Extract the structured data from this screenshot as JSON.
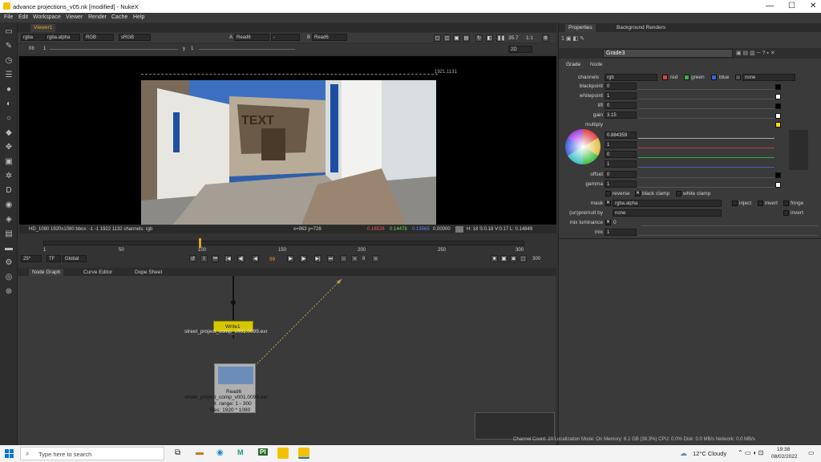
{
  "window": {
    "title": "advance projections_v05.nk [modified] - NukeX",
    "min": "—",
    "max": "☐",
    "close": "✕"
  },
  "menu": [
    "File",
    "Edit",
    "Workspace",
    "Viewer",
    "Render",
    "Cache",
    "Help"
  ],
  "viewer": {
    "tab": "Viewer1",
    "channels": "rgba",
    "alpha": "rgba.alpha",
    "colorspace": "RGB",
    "lut": "sRGB",
    "a_label": "A",
    "a_input": "Read6",
    "b_label": "B",
    "b_input": "Read6",
    "gain_label": "f/8",
    "gain_value": "1",
    "gamma_label": "y",
    "gamma_value": "1",
    "zoom": "35.7",
    "zoom_ratio": "1:1",
    "view_mode": "2D",
    "format_corner": "1921,1131",
    "info_left": "HD_1080 1920x1080  bbox: -1 -1 1922 1132 channels: rgb",
    "info_xy": "x=963 y=728",
    "info_r": "0.16526",
    "info_g": "0.14478",
    "info_b": "0.13565",
    "info_a": "0.00000",
    "info_hsvl": "H: 18 S:0.18 V:0.17  L: 0.14849",
    "overlay_text": "TEXT"
  },
  "timeline": {
    "ticks": [
      "1",
      "50",
      "100",
      "150",
      "200",
      "250",
      "300"
    ],
    "fps": "25*",
    "tf": "TF",
    "scope": "Global",
    "current_frame": "99",
    "step": "8",
    "end_frame": "300"
  },
  "nodegraph": {
    "tabs": [
      "Node Graph",
      "Curve Editor",
      "Dope Sheet"
    ],
    "write": {
      "name": "Write1",
      "file": "street_project_comp_v001.0099.exr"
    },
    "read": {
      "name": "Read6",
      "file": "street_project_comp_v001.0099.exr",
      "range": "fr. range: 1 - 300",
      "res": "Res: 1920 * 1080"
    }
  },
  "properties": {
    "tabs": [
      "Properties",
      "Background Renders"
    ],
    "node_name": "Grade3",
    "subtabs": [
      "Grade",
      "Node"
    ],
    "channels": {
      "label": "channels",
      "value": "rgb",
      "red": "red",
      "green": "green",
      "blue": "blue",
      "extra": "none"
    },
    "rows": [
      {
        "label": "blackpoint",
        "value": "0"
      },
      {
        "label": "whitepoint",
        "value": "1"
      },
      {
        "label": "lift",
        "value": "0"
      },
      {
        "label": "gain",
        "value": "3.15"
      }
    ],
    "multiply": {
      "label": "multiply",
      "values": [
        "0.884359",
        "1",
        "0",
        "1"
      ]
    },
    "offset": {
      "label": "offset",
      "value": "0"
    },
    "gamma": {
      "label": "gamma",
      "value": "1"
    },
    "clamp": {
      "reverse": "reverse",
      "black": "black clamp",
      "white": "white clamp"
    },
    "mask": {
      "label": "mask",
      "value": "rgba.alpha",
      "inject": "inject",
      "invert": "invert",
      "fringe": "fringe"
    },
    "unpremult": {
      "label": "(un)premult by",
      "value": "none",
      "invert": "invert"
    },
    "mixlum": {
      "label": "mix luminance",
      "value": "0"
    },
    "mix": {
      "label": "mix",
      "value": "1"
    }
  },
  "status": "Channel Count: 20  Localization Mode: On  Memory: 6.1 GB (38.3%)  CPU: 0.0%  Disk: 0.0 MB/s  Network: 0.0 MB/s",
  "taskbar": {
    "search": "Type here to search",
    "weather": "12°C  Cloudy",
    "time": "19:38",
    "date": "08/02/2022"
  }
}
